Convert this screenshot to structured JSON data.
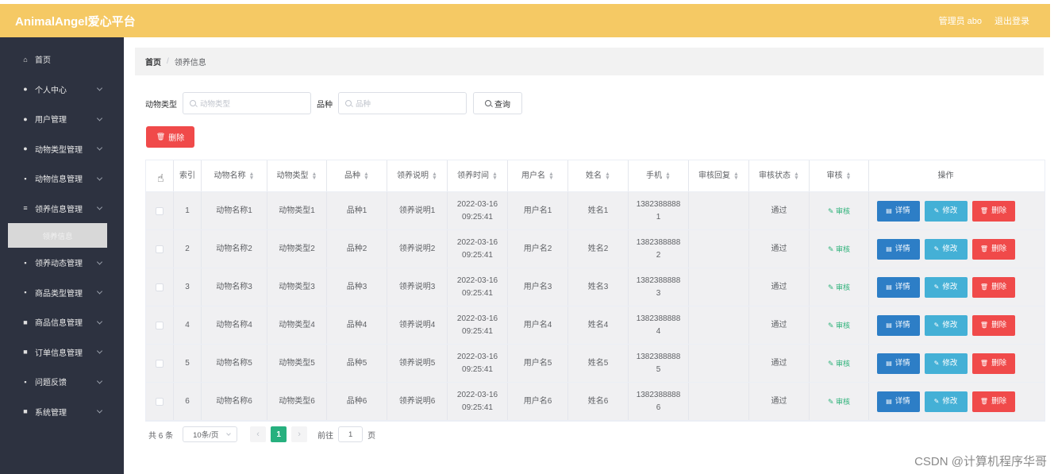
{
  "header": {
    "brand": "AnimalAngel爱心平台",
    "user": "管理员 abo",
    "logout": "退出登录"
  },
  "sidebar": {
    "items": [
      {
        "label": "首页",
        "icon": "home-icon",
        "chevron": false
      },
      {
        "label": "个人中心",
        "icon": "user-icon",
        "chevron": true
      },
      {
        "label": "用户管理",
        "icon": "user-icon",
        "chevron": true
      },
      {
        "label": "动物类型管理",
        "icon": "pin-icon",
        "chevron": true
      },
      {
        "label": "动物信息管理",
        "icon": "grid-icon",
        "chevron": true
      },
      {
        "label": "领养信息管理",
        "icon": "list-icon",
        "chevron": true
      }
    ],
    "active_sub": "领养信息",
    "items_after": [
      {
        "label": "领养动态管理",
        "icon": "grid-icon",
        "chevron": true
      },
      {
        "label": "商品类型管理",
        "icon": "grid-icon",
        "chevron": true
      },
      {
        "label": "商品信息管理",
        "icon": "doc-icon",
        "chevron": true
      },
      {
        "label": "订单信息管理",
        "icon": "order-icon",
        "chevron": true
      },
      {
        "label": "问题反馈",
        "icon": "grid-icon",
        "chevron": true
      },
      {
        "label": "系统管理",
        "icon": "clipboard-icon",
        "chevron": true
      }
    ]
  },
  "breadcrumb": {
    "home": "首页",
    "sep": "/",
    "current": "领养信息"
  },
  "search": {
    "type_label": "动物类型",
    "type_placeholder": "动物类型",
    "breed_label": "品种",
    "breed_placeholder": "品种",
    "query_label": "查询"
  },
  "delete_label": "删除",
  "table": {
    "headers": [
      "索引",
      "动物名称",
      "动物类型",
      "品种",
      "领养说明",
      "领养时间",
      "用户名",
      "姓名",
      "手机",
      "审核回复",
      "审核状态",
      "审核",
      "操作"
    ],
    "rows": [
      {
        "idx": "1",
        "name": "动物名称1",
        "type": "动物类型1",
        "breed": "品种1",
        "desc": "领养说明1",
        "date": "2022-03-16",
        "time": "09:25:41",
        "user": "用户名1",
        "real": "姓名1",
        "phone1": "1382388888",
        "phone2": "1",
        "reply": "",
        "status": "通过",
        "audit": "审核"
      },
      {
        "idx": "2",
        "name": "动物名称2",
        "type": "动物类型2",
        "breed": "品种2",
        "desc": "领养说明2",
        "date": "2022-03-16",
        "time": "09:25:41",
        "user": "用户名2",
        "real": "姓名2",
        "phone1": "1382388888",
        "phone2": "2",
        "reply": "",
        "status": "通过",
        "audit": "审核"
      },
      {
        "idx": "3",
        "name": "动物名称3",
        "type": "动物类型3",
        "breed": "品种3",
        "desc": "领养说明3",
        "date": "2022-03-16",
        "time": "09:25:41",
        "user": "用户名3",
        "real": "姓名3",
        "phone1": "1382388888",
        "phone2": "3",
        "reply": "",
        "status": "通过",
        "audit": "审核"
      },
      {
        "idx": "4",
        "name": "动物名称4",
        "type": "动物类型4",
        "breed": "品种4",
        "desc": "领养说明4",
        "date": "2022-03-16",
        "time": "09:25:41",
        "user": "用户名4",
        "real": "姓名4",
        "phone1": "1382388888",
        "phone2": "4",
        "reply": "",
        "status": "通过",
        "audit": "审核"
      },
      {
        "idx": "5",
        "name": "动物名称5",
        "type": "动物类型5",
        "breed": "品种5",
        "desc": "领养说明5",
        "date": "2022-03-16",
        "time": "09:25:41",
        "user": "用户名5",
        "real": "姓名5",
        "phone1": "1382388888",
        "phone2": "5",
        "reply": "",
        "status": "通过",
        "audit": "审核"
      },
      {
        "idx": "6",
        "name": "动物名称6",
        "type": "动物类型6",
        "breed": "品种6",
        "desc": "领养说明6",
        "date": "2022-03-16",
        "time": "09:25:41",
        "user": "用户名6",
        "real": "姓名6",
        "phone1": "1382388888",
        "phone2": "6",
        "reply": "",
        "status": "通过",
        "audit": "审核"
      }
    ],
    "ops": {
      "detail": "详情",
      "edit": "修改",
      "delete": "删除"
    }
  },
  "pager": {
    "total": "共 6 条",
    "size": "10条/页",
    "current": "1",
    "goto": "前往",
    "page_input": "1",
    "page_suffix": "页",
    "prev": "‹",
    "next": "›"
  },
  "watermark": "CSDN @计算机程序华哥",
  "colors": {
    "topbar": "#f5c964",
    "sidebar": "#2d3240",
    "danger": "#f04a4a",
    "primary": "#2d7ec6",
    "info": "#44b0d6",
    "success": "#27b07e"
  }
}
